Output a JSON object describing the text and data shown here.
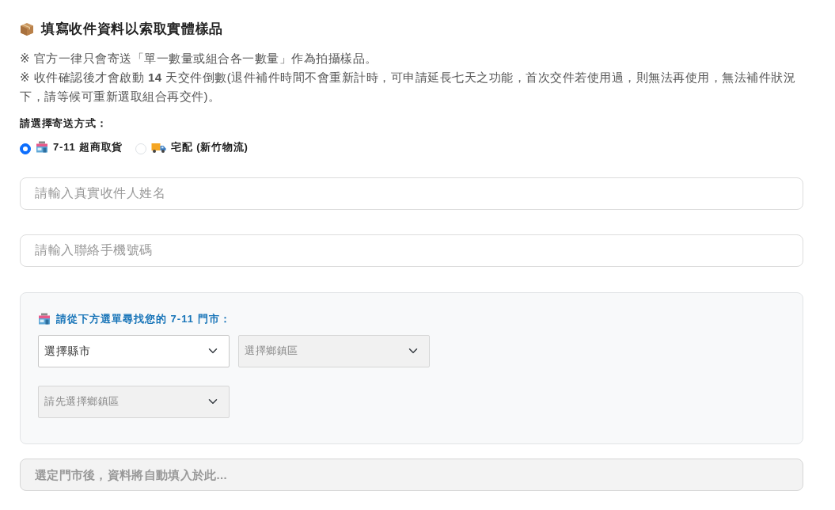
{
  "heading": {
    "text": "填寫收件資料以索取實體樣品"
  },
  "notes": [
    "※ 官方一律只會寄送「單一數量或組合各一數量」作為拍攝樣品。",
    "※ 收件確認後才會啟動 **14** 天交件倒數(退件補件時間不會重新計時，可申請延長七天之功能，首次交件若使用過，則無法再使用，無法補件狀況下，請等候可重新選取組合再交件)。"
  ],
  "shipping": {
    "label": "請選擇寄送方式：",
    "options": [
      {
        "kind": "store",
        "label": "7-11 超商取貨",
        "selected": true
      },
      {
        "kind": "truck",
        "label": "宅配 (新竹物流)",
        "selected": false
      }
    ]
  },
  "fields": [
    {
      "placeholder": "請輸入真實收件人姓名"
    },
    {
      "placeholder": "請輸入聯絡手機號碼"
    }
  ],
  "store_finder": {
    "title": "請從下方選單尋找您的 7-11 門市：",
    "selects": [
      {
        "value": "選擇縣市",
        "disabled": false
      },
      {
        "value": "選擇鄉鎮區",
        "disabled": true
      },
      {
        "value": "請先選擇鄉鎮區",
        "disabled": true
      }
    ]
  },
  "address": {
    "placeholder": "選定門市後，資料將自動填入於此...",
    "disabled": true
  }
}
